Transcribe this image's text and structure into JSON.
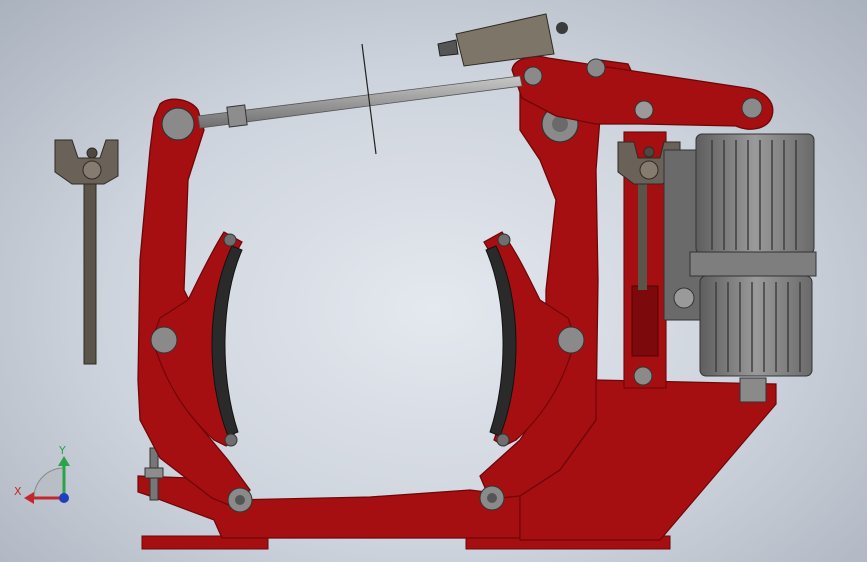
{
  "viewport": {
    "background_top": "#e4e8ef",
    "background_edge": "#aab2be"
  },
  "model": {
    "frame_color": "#a60f12",
    "frame_shadow": "#6e0608",
    "frame_highlight": "#c8282a",
    "pin_color": "#8a8a8a",
    "shoe_lining_color": "#2a2a2a",
    "actuator_color": "#7c7c7c",
    "rod_color": "#9a9a9a",
    "bracket_color": "#6a6258"
  },
  "triad": {
    "x_label": "X",
    "y_label": "Y",
    "x_color": "#c2282a",
    "y_color": "#2aa34a",
    "origin_color": "#1f3fbf"
  }
}
